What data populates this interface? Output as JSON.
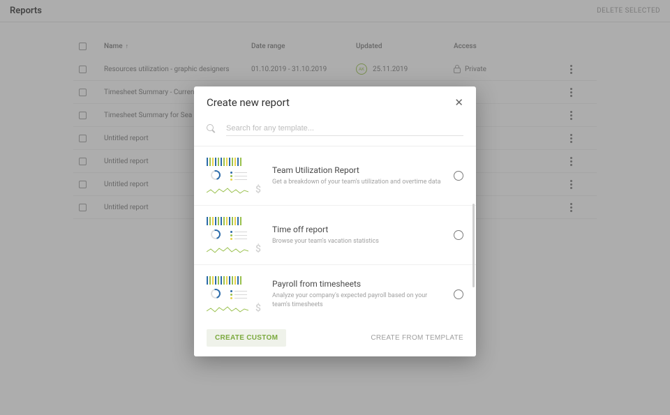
{
  "page": {
    "title": "Reports",
    "delete_label": "DELETE SELECTED"
  },
  "columns": {
    "name": "Name",
    "date_range": "Date range",
    "updated": "Updated",
    "access": "Access"
  },
  "rows": [
    {
      "name": "Resources utilization - graphic designers",
      "date_range": "01.10.2019 - 31.10.2019",
      "updated": "25.11.2019",
      "avatar": "AK",
      "access": "Private"
    },
    {
      "name": "Timesheet Summary - Current Month",
      "date_range": "",
      "updated": "",
      "avatar": "",
      "access": "ate"
    },
    {
      "name": "Timesheet Summary for Sea Hotels b",
      "date_range": "",
      "updated": "",
      "avatar": "",
      "access": ""
    },
    {
      "name": "Untitled report",
      "date_range": "",
      "updated": "",
      "avatar": "",
      "access": "ate"
    },
    {
      "name": "Untitled report",
      "date_range": "",
      "updated": "",
      "avatar": "",
      "access": "ate"
    },
    {
      "name": "Untitled report",
      "date_range": "",
      "updated": "",
      "avatar": "",
      "access": "ate"
    },
    {
      "name": "Untitled report",
      "date_range": "",
      "updated": "",
      "avatar": "",
      "access": "ate"
    }
  ],
  "modal": {
    "title": "Create new report",
    "search_placeholder": "Search for any template...",
    "templates": [
      {
        "title": "Team Utilization Report",
        "desc": "Get a breakdown of your team's utilization and overtime data"
      },
      {
        "title": "Time off report",
        "desc": "Browse your team's vacation statistics"
      },
      {
        "title": "Payroll from timesheets",
        "desc": "Analyze your company's expected payroll based on your team's timesheets"
      }
    ],
    "btn_custom": "CREATE CUSTOM",
    "btn_template": "CREATE FROM TEMPLATE"
  }
}
